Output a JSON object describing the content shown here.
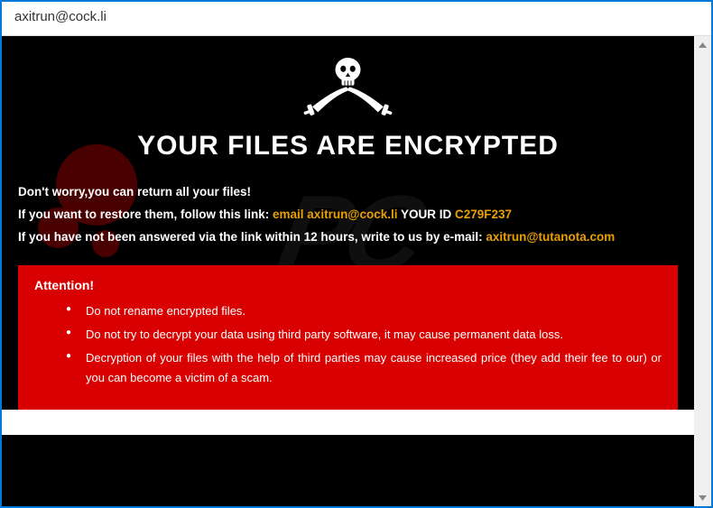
{
  "window": {
    "title": "axitrun@cock.li"
  },
  "content": {
    "headline": "YOUR FILES ARE ENCRYPTED",
    "line1": "Don't worry,you can return all your files!",
    "line2a": "If you want to restore them, follow this link: ",
    "line2_email": "email axitrun@cock.li",
    "line2b": "  YOUR ID ",
    "line2_id": "C279F237",
    "line3a": "If you have not been answered via the link within 12 hours, write to us by e-mail: ",
    "line3_email2": "axitrun@tutanota.com"
  },
  "attention": {
    "title": "Attention!",
    "items": [
      "Do not rename encrypted files.",
      "Do not try to decrypt your data using third party software, it may cause permanent data loss.",
      "Decryption of your files with the help of third parties may cause increased price (they add their fee to our) or you can become a victim of a scam."
    ]
  },
  "scroll": {
    "up": "⌃",
    "down": "⌄"
  }
}
